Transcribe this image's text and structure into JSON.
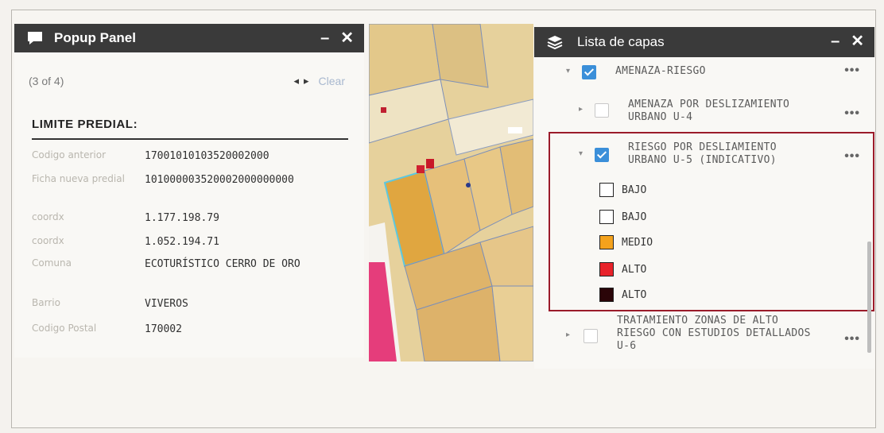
{
  "popup": {
    "title": "Popup Panel",
    "minimize": "–",
    "close": "✕",
    "count": "(3 of 4)",
    "prev": "◂",
    "next": "▸",
    "clear": "Clear",
    "heading": "LIMITE PREDIAL:",
    "attributes": [
      {
        "key": "Codigo anterior",
        "value": "17001010103520002000"
      },
      {
        "key": "Ficha nueva predial",
        "value": "101000003520002000000000"
      },
      {
        "key": "coordx",
        "value": "1.177.198.79"
      },
      {
        "key": "coordx",
        "value": "1.052.194.71"
      },
      {
        "key": "Comuna",
        "value": "ECOTURÍSTICO CERRO DE ORO"
      },
      {
        "key": "Barrio",
        "value": "VIVEROS"
      },
      {
        "key": "Codigo Postal",
        "value": "170002"
      }
    ]
  },
  "layers": {
    "title": "Lista de capas",
    "minimize": "–",
    "close": "✕",
    "more": "•••",
    "items": [
      {
        "label": "AMENAZA-RIESGO",
        "checked": true,
        "expanded": true
      },
      {
        "label": "AMENAZA POR DESLIZAMIENTO URBANO U-4",
        "checked": false,
        "expanded": false
      },
      {
        "label": "RIESGO POR DESLIAMIENTO URBANO U-5 (INDICATIVO)",
        "checked": true,
        "expanded": true
      },
      {
        "label": "TRATAMIENTO ZONAS DE ALTO RIESGO CON ESTUDIOS DETALLADOS U-6",
        "checked": false,
        "expanded": false
      }
    ],
    "legend": [
      {
        "label": "BAJO",
        "color": "#ffffff"
      },
      {
        "label": "BAJO",
        "color": "#ffffff"
      },
      {
        "label": "MEDIO",
        "color": "#f4a21c"
      },
      {
        "label": "ALTO",
        "color": "#e8222a"
      },
      {
        "label": "ALTO",
        "color": "#2a0508"
      }
    ]
  },
  "colors": {
    "titlebar": "#3a3a3a",
    "highlight_border": "#9b1b2a",
    "checkbox_checked": "#3b8fd9"
  }
}
